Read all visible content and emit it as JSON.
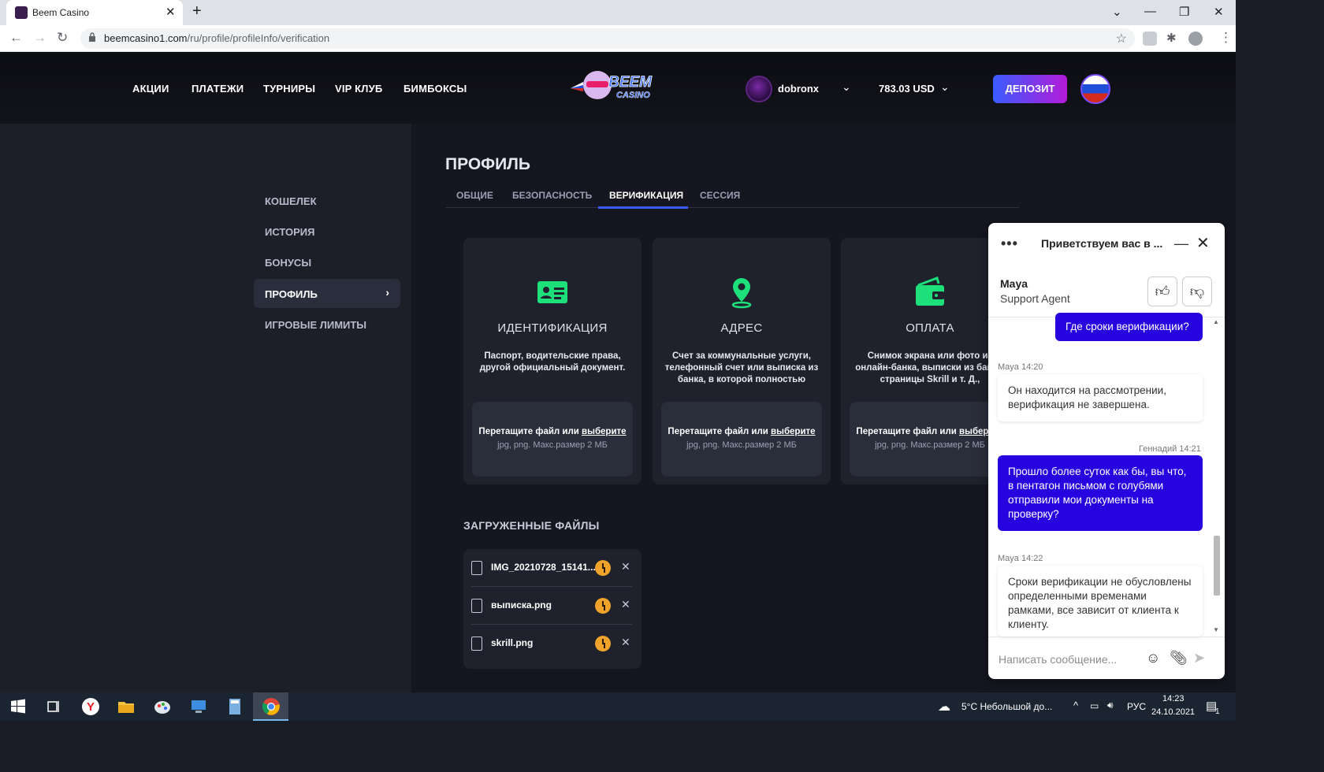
{
  "browser": {
    "tab_title": "Beem Casino",
    "url_domain": "beemcasino1.com",
    "url_path": "/ru/profile/profileInfo/verification"
  },
  "header": {
    "nav": [
      "АКЦИИ",
      "ПЛАТЕЖИ",
      "ТУРНИРЫ",
      "VIP КЛУБ",
      "БИМБОКСЫ"
    ],
    "logo_text": "BEEM CASINO",
    "username": "dobronx",
    "balance": "783.03 USD",
    "deposit_label": "ДЕПОЗИТ",
    "language": "ru"
  },
  "sidebar": {
    "items": [
      {
        "label": "КОШЕЛЕК"
      },
      {
        "label": "ИСТОРИЯ"
      },
      {
        "label": "БОНУСЫ"
      },
      {
        "label": "ПРОФИЛЬ"
      },
      {
        "label": "ИГРОВЫЕ ЛИМИТЫ"
      }
    ],
    "active": "ПРОФИЛЬ"
  },
  "profile": {
    "title": "ПРОФИЛЬ",
    "tabs": [
      "ОБЩИЕ",
      "БЕЗОПАСНОСТЬ",
      "ВЕРИФИКАЦИЯ",
      "СЕССИЯ"
    ],
    "active_tab": "ВЕРИФИКАЦИЯ",
    "cards": [
      {
        "icon": "id-card-icon",
        "title": "ИДЕНТИФИКАЦИЯ",
        "desc": "Паспорт, водительские права, другой официальный документ.",
        "drop_text": "Перетащите файл или ",
        "drop_link": "выберите",
        "drop_hint": "jpg, png. Макс.размер 2 МБ"
      },
      {
        "icon": "map-pin-icon",
        "title": "АДРЕС",
        "desc": "Счет за коммунальные услуги, телефонный счет или выписка из банка, в которой полностью",
        "drop_text": "Перетащите файл или ",
        "drop_link": "выберите",
        "drop_hint": "jpg, png. Макс.размер 2 МБ"
      },
      {
        "icon": "wallet-icon",
        "title": "ОПЛАТА",
        "desc": "Снимок экрана или фото из онлайн-банка, выписки из банка, страницы Skrill и т. Д.,",
        "drop_text": "Перетащите файл или ",
        "drop_link": "выберите",
        "drop_hint": "jpg, png. Макс.размер 2 МБ"
      }
    ],
    "accent_green": "#1ee07a",
    "uploaded_title": "ЗАГРУЖЕННЫЕ ФАЙЛЫ",
    "files": [
      {
        "name": "IMG_20210728_15141...",
        "status": "pending-clock-icon"
      },
      {
        "name": "выписка.png",
        "status": "pending-clock-icon"
      },
      {
        "name": "skrill.png",
        "status": "pending-clock-icon"
      }
    ]
  },
  "chat": {
    "title": "Приветствуем вас в ...",
    "agent_name": "Maya",
    "agent_role": "Support Agent",
    "messages": [
      {
        "from": "user",
        "text": "Где сроки верификации?"
      },
      {
        "from": "agent",
        "meta": "Maya 14:20",
        "text": "Он находится на рассмотрении, верификация не завершена."
      },
      {
        "from": "user",
        "meta": "Геннадий 14:21",
        "text": "Прошло более суток как бы, вы что, в пентагон письмом с голубями отправили мои документы на проверку?"
      },
      {
        "from": "agent",
        "meta": "Maya 14:22",
        "text": "Сроки верификации не обусловлены определенными временами рамками, все зависит от клиента к клиенту."
      }
    ],
    "input_placeholder": "Написать сообщение...",
    "bubble_color": "#2703e0"
  },
  "taskbar": {
    "weather": "5°C  Небольшой до...",
    "lang": "РУС",
    "time": "14:23",
    "date": "24.10.2021",
    "notifications": "1"
  }
}
